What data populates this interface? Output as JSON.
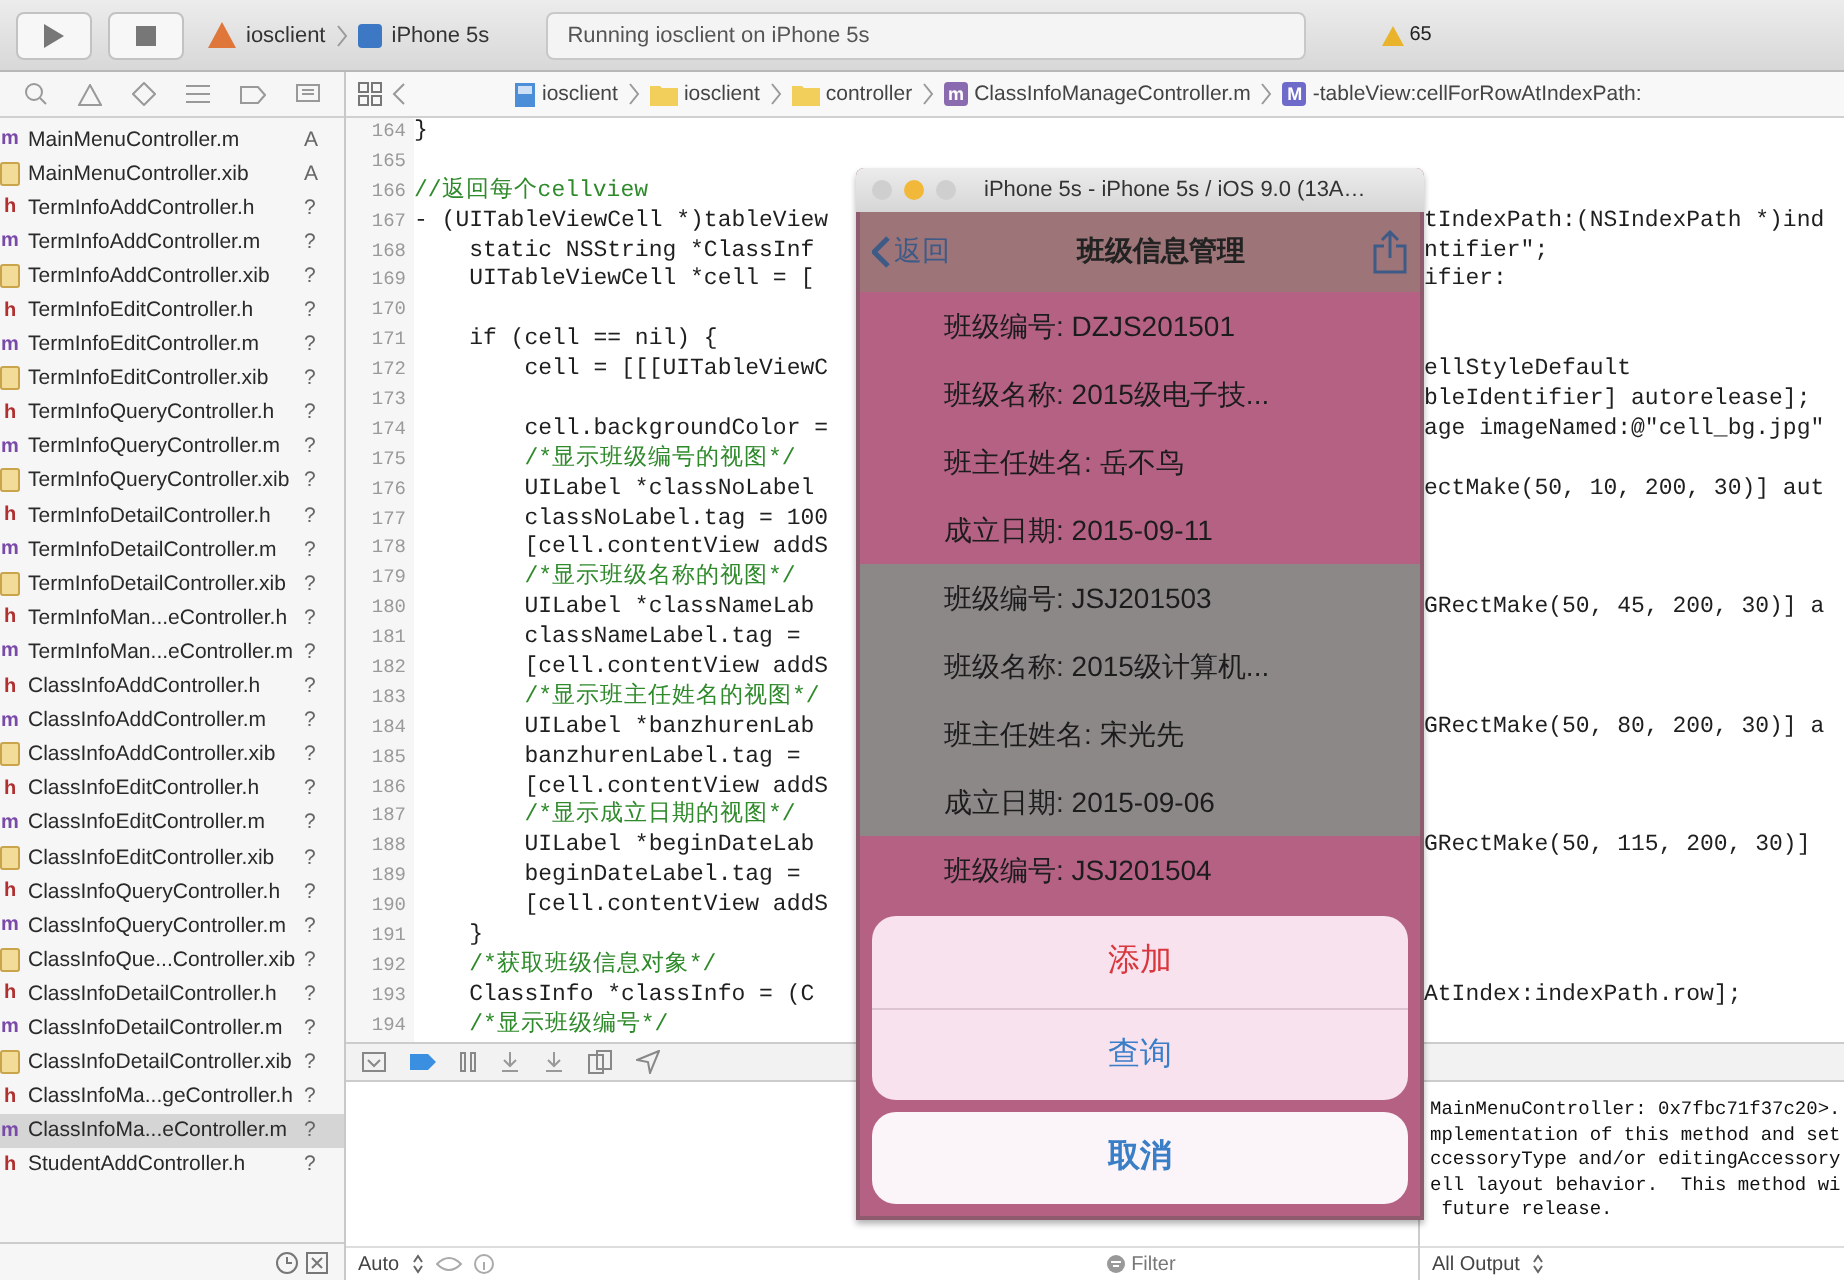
{
  "toolbar": {
    "scheme": "iosclient",
    "device": "iPhone 5s",
    "status": "Running iosclient on iPhone 5s",
    "warnings": "65"
  },
  "navigator": {
    "files": [
      {
        "name": "MainMenuController.m",
        "kind": "implementation",
        "badge": "m",
        "status": "A",
        "selected": false
      },
      {
        "name": "MainMenuController.xib",
        "kind": "interface",
        "status": "A",
        "selected": false
      },
      {
        "name": "TermInfoAddController.h",
        "kind": "header",
        "badge": "h",
        "status": "?",
        "selected": false
      },
      {
        "name": "TermInfoAddController.m",
        "kind": "implementation",
        "badge": "m",
        "status": "?",
        "selected": false
      },
      {
        "name": "TermInfoAddController.xib",
        "kind": "interface",
        "status": "?",
        "selected": false
      },
      {
        "name": "TermInfoEditController.h",
        "kind": "header",
        "badge": "h",
        "status": "?",
        "selected": false
      },
      {
        "name": "TermInfoEditController.m",
        "kind": "implementation",
        "badge": "m",
        "status": "?",
        "selected": false
      },
      {
        "name": "TermInfoEditController.xib",
        "kind": "interface",
        "status": "?",
        "selected": false
      },
      {
        "name": "TermInfoQueryController.h",
        "kind": "header",
        "badge": "h",
        "status": "?",
        "selected": false
      },
      {
        "name": "TermInfoQueryController.m",
        "kind": "implementation",
        "badge": "m",
        "status": "?",
        "selected": false
      },
      {
        "name": "TermInfoQueryController.xib",
        "kind": "interface",
        "status": "?",
        "selected": false
      },
      {
        "name": "TermInfoDetailController.h",
        "kind": "header",
        "badge": "h",
        "status": "?",
        "selected": false
      },
      {
        "name": "TermInfoDetailController.m",
        "kind": "implementation",
        "badge": "m",
        "status": "?",
        "selected": false
      },
      {
        "name": "TermInfoDetailController.xib",
        "kind": "interface",
        "status": "?",
        "selected": false
      },
      {
        "name": "TermInfoMan...eController.h",
        "kind": "header",
        "badge": "h",
        "status": "?",
        "selected": false
      },
      {
        "name": "TermInfoMan...eController.m",
        "kind": "implementation",
        "badge": "m",
        "status": "?",
        "selected": false
      },
      {
        "name": "ClassInfoAddController.h",
        "kind": "header",
        "badge": "h",
        "status": "?",
        "selected": false
      },
      {
        "name": "ClassInfoAddController.m",
        "kind": "implementation",
        "badge": "m",
        "status": "?",
        "selected": false
      },
      {
        "name": "ClassInfoAddController.xib",
        "kind": "interface",
        "status": "?",
        "selected": false
      },
      {
        "name": "ClassInfoEditController.h",
        "kind": "header",
        "badge": "h",
        "status": "?",
        "selected": false
      },
      {
        "name": "ClassInfoEditController.m",
        "kind": "implementation",
        "badge": "m",
        "status": "?",
        "selected": false
      },
      {
        "name": "ClassInfoEditController.xib",
        "kind": "interface",
        "status": "?",
        "selected": false
      },
      {
        "name": "ClassInfoQueryController.h",
        "kind": "header",
        "badge": "h",
        "status": "?",
        "selected": false
      },
      {
        "name": "ClassInfoQueryController.m",
        "kind": "implementation",
        "badge": "m",
        "status": "?",
        "selected": false
      },
      {
        "name": "ClassInfoQue...Controller.xib",
        "kind": "interface",
        "status": "?",
        "selected": false
      },
      {
        "name": "ClassInfoDetailController.h",
        "kind": "header",
        "badge": "h",
        "status": "?",
        "selected": false
      },
      {
        "name": "ClassInfoDetailController.m",
        "kind": "implementation",
        "badge": "m",
        "status": "?",
        "selected": false
      },
      {
        "name": "ClassInfoDetailController.xib",
        "kind": "interface",
        "status": "?",
        "selected": false
      },
      {
        "name": "ClassInfoMa...geController.h",
        "kind": "header",
        "badge": "h",
        "status": "?",
        "selected": false
      },
      {
        "name": "ClassInfoMa...eController.m",
        "kind": "implementation",
        "badge": "m",
        "status": "?",
        "selected": true
      },
      {
        "name": "StudentAddController.h",
        "kind": "header",
        "badge": "h",
        "status": "?",
        "selected": false
      }
    ]
  },
  "editor": {
    "breadcrumbs": [
      {
        "label": "iosclient",
        "kind": "project"
      },
      {
        "label": "iosclient",
        "kind": "folder"
      },
      {
        "label": "controller",
        "kind": "folder"
      },
      {
        "label": "ClassInfoManageController.m",
        "kind": "file",
        "badge": "m"
      },
      {
        "label": "-tableView:cellForRowAtIndexPath:",
        "kind": "method",
        "badge": "M"
      }
    ],
    "lines": [
      {
        "number": "164",
        "kind": "code",
        "left": "}"
      },
      {
        "number": "165",
        "kind": "code"
      },
      {
        "number": "166",
        "kind": "comment",
        "left": "//返回每个cellview"
      },
      {
        "number": "167",
        "kind": "code",
        "left": "- (UITableViewCell *)tableView",
        "right": "tIndexPath:(NSIndexPath *)ind"
      },
      {
        "number": "168",
        "kind": "code",
        "left": "    static NSString *ClassInf",
        "right": "ntifier\";"
      },
      {
        "number": "169",
        "kind": "code",
        "left": "    UITableViewCell *cell = [",
        "right": "ifier:"
      },
      {
        "number": "170",
        "kind": "code"
      },
      {
        "number": "171",
        "kind": "code",
        "left": "    if (cell == nil) {"
      },
      {
        "number": "172",
        "kind": "code",
        "left": "        cell = [[[UITableViewC",
        "right": "ellStyleDefault"
      },
      {
        "number": "173",
        "kind": "code",
        "right": "bleIdentifier] autorelease];"
      },
      {
        "number": "174",
        "kind": "code",
        "left": "        cell.backgroundColor =",
        "right": "age imageNamed:@\"cell_bg.jpg\""
      },
      {
        "number": "175",
        "kind": "comment",
        "left": "        /*显示班级编号的视图*/"
      },
      {
        "number": "176",
        "kind": "code",
        "left": "        UILabel *classNoLabel",
        "right": "ectMake(50, 10, 200, 30)] aut"
      },
      {
        "number": "177",
        "kind": "code",
        "left": "        classNoLabel.tag = 100"
      },
      {
        "number": "178",
        "kind": "code",
        "left": "        [cell.contentView addS"
      },
      {
        "number": "179",
        "kind": "comment",
        "left": "        /*显示班级名称的视图*/"
      },
      {
        "number": "180",
        "kind": "code",
        "left": "        UILabel *classNameLab",
        "right": "GRectMake(50, 45, 200, 30)] a"
      },
      {
        "number": "181",
        "kind": "code",
        "left": "        classNameLabel.tag ="
      },
      {
        "number": "182",
        "kind": "code",
        "left": "        [cell.contentView addS"
      },
      {
        "number": "183",
        "kind": "comment",
        "left": "        /*显示班主任姓名的视图*/"
      },
      {
        "number": "184",
        "kind": "code",
        "left": "        UILabel *banzhurenLab",
        "right": "GRectMake(50, 80, 200, 30)] a"
      },
      {
        "number": "185",
        "kind": "code",
        "left": "        banzhurenLabel.tag ="
      },
      {
        "number": "186",
        "kind": "code",
        "left": "        [cell.contentView addS"
      },
      {
        "number": "187",
        "kind": "comment",
        "left": "        /*显示成立日期的视图*/"
      },
      {
        "number": "188",
        "kind": "code",
        "left": "        UILabel *beginDateLab",
        "right": "GRectMake(50, 115, 200, 30)]"
      },
      {
        "number": "189",
        "kind": "code",
        "left": "        beginDateLabel.tag ="
      },
      {
        "number": "190",
        "kind": "code",
        "left": "        [cell.contentView addS"
      },
      {
        "number": "191",
        "kind": "code",
        "left": "    }"
      },
      {
        "number": "192",
        "kind": "comment",
        "left": "    /*获取班级信息对象*/"
      },
      {
        "number": "193",
        "kind": "code",
        "left": "    ClassInfo *classInfo = (C",
        "right": "AtIndex:indexPath.row];"
      },
      {
        "number": "194",
        "kind": "comment",
        "left": "    /*显示班级编号*/"
      }
    ]
  },
  "debug": {
    "variables_scope": "Auto",
    "filter": {
      "placeholder": "Filter"
    },
    "console_scope": "All Output",
    "console_lines": [
      "MainMenuController: 0x7fbc71f37c20>.",
      "mplementation of this method and set",
      "ccessoryType and/or editingAccessory",
      "ell layout behavior.  This method wi",
      " future release."
    ]
  },
  "simulator": {
    "title": "iPhone 5s - iPhone 5s / iOS 9.0 (13A…",
    "nav": {
      "back": "返回",
      "title": "班级信息管理"
    },
    "cells": [
      {
        "selected": false,
        "lines": [
          "班级编号: DZJS201501",
          "班级名称: 2015级电子技...",
          "班主任姓名: 岳不鸟",
          "成立日期: 2015-09-11"
        ]
      },
      {
        "selected": true,
        "lines": [
          "班级编号: JSJ201503",
          "班级名称: 2015级计算机...",
          "班主任姓名: 宋光先",
          "成立日期: 2015-09-06"
        ]
      },
      {
        "selected": false,
        "lines": [
          "班级编号: JSJ201504"
        ]
      }
    ],
    "actions": [
      {
        "label": "添加",
        "kind": "destructive"
      },
      {
        "label": "查询",
        "kind": "default"
      },
      {
        "label": "取消",
        "kind": "cancel"
      }
    ]
  }
}
